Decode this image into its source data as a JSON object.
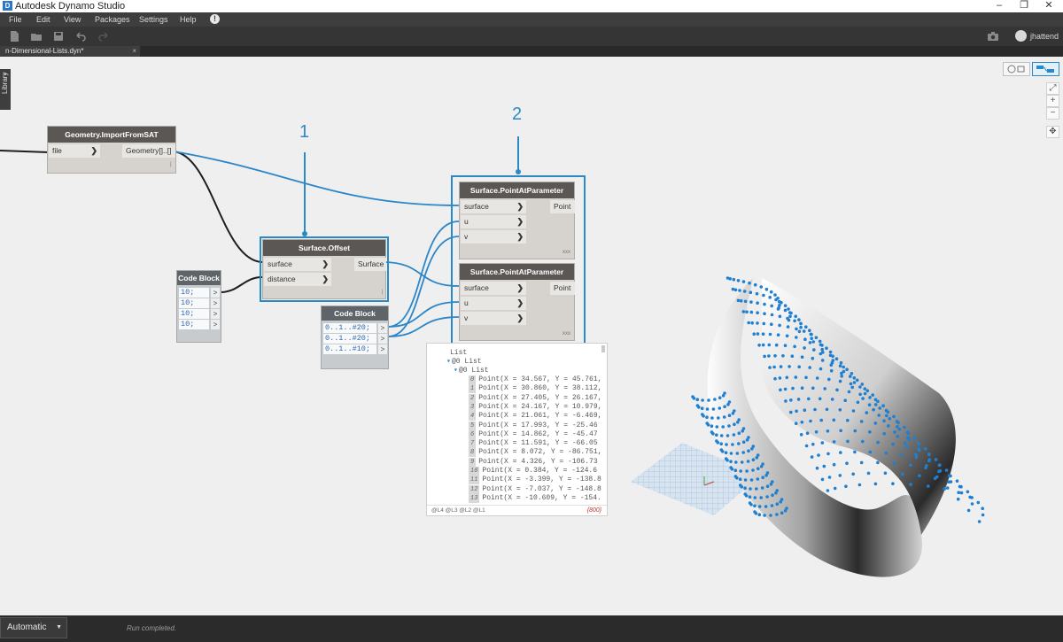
{
  "window": {
    "title": "Autodesk Dynamo Studio",
    "icon": "D"
  },
  "menu": {
    "items": [
      "File",
      "Edit",
      "View",
      "Packages",
      "Settings",
      "Help"
    ]
  },
  "toolbar": {
    "user": "jhattend"
  },
  "tab": {
    "name": "n-Dimensional-Lists.dyn*",
    "close": "×"
  },
  "library": {
    "label": "Library"
  },
  "nodes": {
    "import": {
      "title": "Geometry.ImportFromSAT",
      "in": "file",
      "out": "Geometry[]..[]",
      "foot": "|"
    },
    "offset": {
      "title": "Surface.Offset",
      "in1": "surface",
      "in2": "distance",
      "out": "Surface",
      "foot": "|"
    },
    "pap1": {
      "title": "Surface.PointAtParameter",
      "in1": "surface",
      "in2": "u",
      "in3": "v",
      "out": "Point",
      "foot": "xxx"
    },
    "pap2": {
      "title": "Surface.PointAtParameter",
      "in1": "surface",
      "in2": "u",
      "in3": "v",
      "out": "Point",
      "foot": "xxx"
    },
    "cb1": {
      "title": "Code Block",
      "lines": [
        "10;",
        "10;",
        "10;",
        "10;"
      ]
    },
    "cb2": {
      "title": "Code Block",
      "lines": [
        "0..1..#20;",
        "0..1..#20;",
        "0..1..#10;"
      ]
    }
  },
  "callouts": {
    "one": "1",
    "two": "2"
  },
  "preview": {
    "root": "List",
    "level1": "@0 List",
    "level2": "@0 List",
    "items": [
      {
        "i": "0",
        "t": "Point(X = 34.567, Y = 45.761,"
      },
      {
        "i": "1",
        "t": "Point(X = 30.860, Y = 38.112,"
      },
      {
        "i": "2",
        "t": "Point(X = 27.405, Y = 26.167,"
      },
      {
        "i": "3",
        "t": "Point(X = 24.167, Y = 10.979,"
      },
      {
        "i": "4",
        "t": "Point(X = 21.061, Y = -6.469,"
      },
      {
        "i": "5",
        "t": "Point(X = 17.993, Y = -25.46"
      },
      {
        "i": "6",
        "t": "Point(X = 14.862, Y = -45.47"
      },
      {
        "i": "7",
        "t": "Point(X = 11.591, Y = -66.05"
      },
      {
        "i": "8",
        "t": "Point(X = 8.072, Y = -86.751,"
      },
      {
        "i": "9",
        "t": "Point(X = 4.326, Y = -106.73"
      },
      {
        "i": "10",
        "t": "Point(X = 0.384, Y = -124.6"
      },
      {
        "i": "11",
        "t": "Point(X = -3.399, Y = -138.8"
      },
      {
        "i": "12",
        "t": "Point(X = -7.037, Y = -148.8"
      },
      {
        "i": "13",
        "t": "Point(X = -10.609, Y = -154."
      }
    ],
    "levels": "@L4 @L3 @L2 @L1",
    "count": "{800}"
  },
  "status": {
    "mode": "Automatic",
    "message": "Run completed."
  },
  "colors": {
    "accent": "#2b8ac6",
    "wire_dark": "#1e1e1e",
    "point": "#1f7fd1"
  }
}
